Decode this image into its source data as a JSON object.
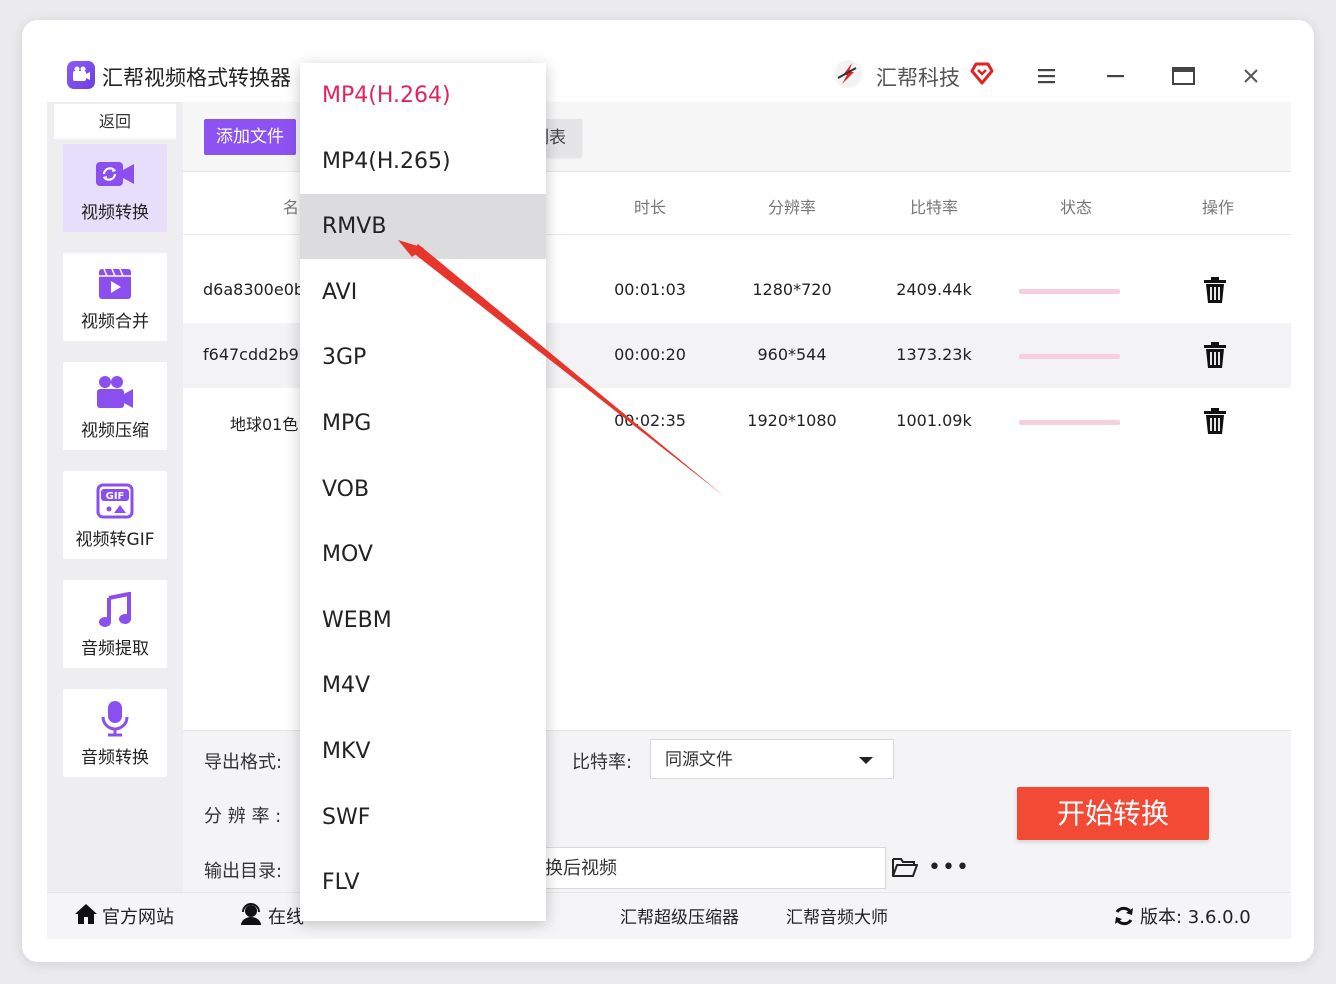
{
  "app": {
    "title": "汇帮视频格式转换器",
    "brand": "汇帮科技"
  },
  "sidebar": {
    "back_label": "返回",
    "items": [
      {
        "label": "视频转换",
        "icon": "video-convert-icon"
      },
      {
        "label": "视频合并",
        "icon": "video-merge-icon"
      },
      {
        "label": "视频压缩",
        "icon": "video-compress-icon"
      },
      {
        "label": "视频转GIF",
        "icon": "gif-icon"
      },
      {
        "label": "音频提取",
        "icon": "music-note-icon"
      },
      {
        "label": "音频转换",
        "icon": "microphone-icon"
      }
    ]
  },
  "toolbar": {
    "add_label": "添加文件",
    "clear_label": "列表"
  },
  "table": {
    "headers": {
      "name": "名",
      "duration": "时长",
      "resolution": "分辨率",
      "bitrate": "比特率",
      "status": "状态",
      "action": "操作"
    },
    "rows": [
      {
        "name": "d6a8300e0b",
        "duration": "00:01:03",
        "resolution": "1280*720",
        "bitrate": "2409.44k"
      },
      {
        "name": "f647cdd2b9",
        "duration": "00:00:20",
        "resolution": "960*544",
        "bitrate": "1373.23k"
      },
      {
        "name": "地球01色",
        "duration": "00:02:35",
        "resolution": "1920*1080",
        "bitrate": "1001.09k"
      }
    ]
  },
  "settings": {
    "export_format_label": "导出格式:",
    "resolution_label": "分 辨 率 :",
    "output_dir_label": "输出目录:",
    "bitrate_label": "比特率:",
    "bitrate_value": "同源文件",
    "output_dir_value": "换后视频",
    "start_label": "开始转换"
  },
  "footer": {
    "website": "官方网站",
    "online": "在线",
    "compressor": "汇帮超级压缩器",
    "audio_master": "汇帮音频大师",
    "version": "版本: 3.6.0.0"
  },
  "dropdown": {
    "options": [
      "MP4(H.264)",
      "MP4(H.265)",
      "RMVB",
      "AVI",
      "3GP",
      "MPG",
      "VOB",
      "MOV",
      "WEBM",
      "M4V",
      "MKV",
      "SWF",
      "FLV"
    ],
    "selected": "MP4(H.264)",
    "hovered": "RMVB"
  },
  "colors": {
    "accent": "#8c52f2",
    "start": "#f24a35",
    "selected_option": "#e0245e",
    "arrow": "#e8352b"
  }
}
